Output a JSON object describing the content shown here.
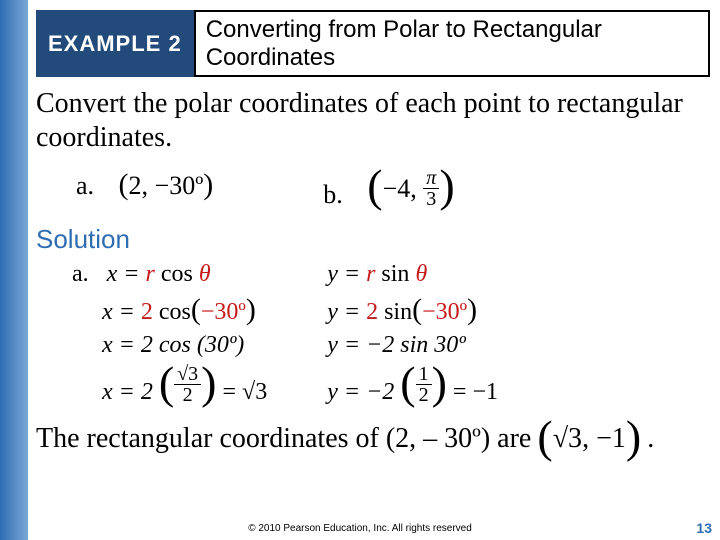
{
  "header": {
    "example_label": "EXAMPLE 2",
    "title": "Converting from Polar to Rectangular Coordinates"
  },
  "prompt": "Convert the polar coordinates of each point to rectangular coordinates.",
  "items": {
    "a": {
      "label": "a.",
      "r": "2",
      "theta": "−30º"
    },
    "b": {
      "label": "b.",
      "r": "−4",
      "theta_num": "π",
      "theta_den": "3"
    }
  },
  "solution_label": "Solution",
  "work": {
    "a_label": "a.",
    "x": {
      "l1_lhs": "x =",
      "l1_rhs_r": "r",
      "l1_rhs_cos": " cos ",
      "l1_rhs_th": "θ",
      "l2": "x = ",
      "l2_num": "2",
      "l2_cos": "cos",
      "l2_ang": "−30º",
      "l3": "x = 2 cos (30º)",
      "l4_lhs": "x = 2",
      "l4_frac_n": "√3",
      "l4_frac_d": "2",
      "l4_eq": " = √3"
    },
    "y": {
      "l1_lhs": "y =",
      "l1_rhs_r": "r",
      "l1_rhs_sin": " sin ",
      "l1_rhs_th": "θ",
      "l2": "y = ",
      "l2_num": "2",
      "l2_sin": "sin",
      "l2_ang": "−30º",
      "l3": "y = −2 sin 30º",
      "l4_lhs": "y = −2",
      "l4_frac_n": "1",
      "l4_frac_d": "2",
      "l4_eq": " = −1"
    }
  },
  "answer": {
    "text": "The rectangular coordinates of (2, – 30º) are",
    "tuple_a": "√3",
    "tuple_b": "−1",
    "period": "."
  },
  "footer": {
    "copyright": "© 2010 Pearson Education, Inc.  All rights reserved",
    "page": "13"
  }
}
